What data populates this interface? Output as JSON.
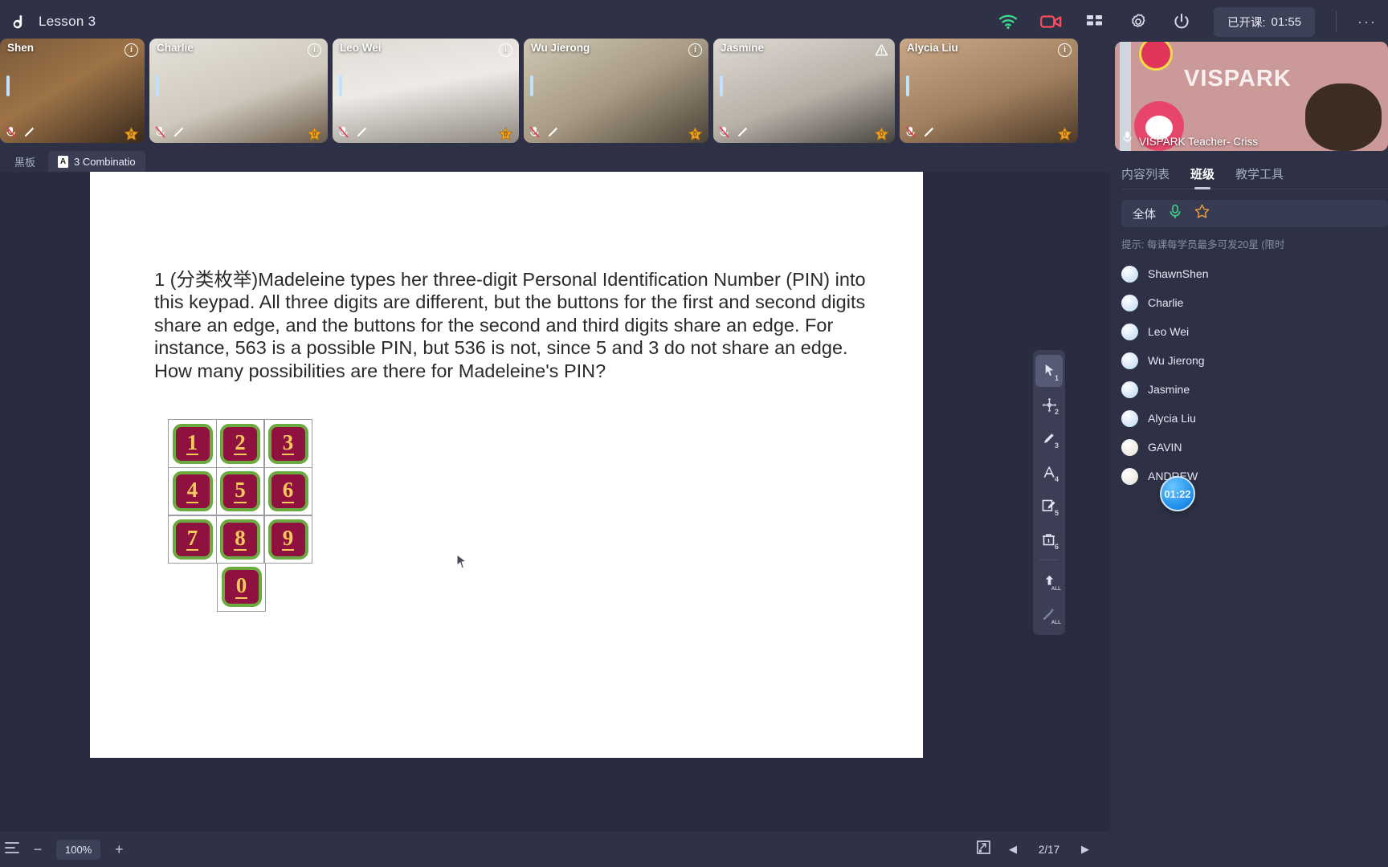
{
  "topbar": {
    "logo": "d-logo-icon",
    "lesson_title": "Lesson 3",
    "icons": [
      "wifi-icon",
      "camera-icon",
      "grid-layout-icon",
      "settings-gear-icon",
      "power-icon"
    ],
    "timer_label": "已开课:",
    "timer_value": "01:55",
    "more_label": "···"
  },
  "videos": [
    {
      "name": "Shen",
      "info": "i",
      "stars": "0",
      "bg": "linear-gradient(150deg,#7c5a3a,#9d7347 45%,#3a2a1c)"
    },
    {
      "name": "Charlie",
      "info": "i",
      "stars": "0",
      "bg": "linear-gradient(160deg,#e6e2da,#cfc9bd 55%,#6c5b4a)"
    },
    {
      "name": "Leo Wei",
      "info": "i",
      "stars": "0",
      "bg": "linear-gradient(170deg,#dedad4,#eeeae6 45%,#8e8880)"
    },
    {
      "name": "Wu Jierong",
      "info": "i",
      "stars": "0",
      "bg": "linear-gradient(150deg,#cfc7b4,#a89b86 50%,#4d4336)"
    },
    {
      "name": "Jasmine",
      "info": "!",
      "stars": "0",
      "bg": "linear-gradient(160deg,#ded9d2,#b7b1a8 55%,#4a4540)"
    },
    {
      "name": "Alycia Liu",
      "info": "i",
      "stars": "0",
      "bg": "linear-gradient(160deg,#c9a887,#a07f5e 55%,#4e3a28)"
    }
  ],
  "teacher": {
    "name": "VISPARK Teacher- Criss",
    "watermark": "VISPARK",
    "mic": "mic-icon"
  },
  "tabs": [
    {
      "label": "黑板",
      "active": false,
      "icon": null
    },
    {
      "label": "3 Combinatio",
      "active": true,
      "icon": "pdf-icon"
    }
  ],
  "board": {
    "problem_text": "1 (分类枚举)Madeleine types her three-digit Personal Identification Number (PIN) into this keypad. All three digits are different, but the buttons for the first and second digits share an edge, and the buttons for the second and third digits share an edge. For instance, 563 is a possible PIN, but 536 is not, since 5 and 3 do not share an edge. How many possibilities are there for Madeleine's PIN?",
    "keypad": {
      "rows": [
        [
          "1",
          "2",
          "3"
        ],
        [
          "4",
          "5",
          "6"
        ],
        [
          "7",
          "8",
          "9"
        ]
      ],
      "zero": "0",
      "button_fill": "#8f1140",
      "button_border": "#6aaa3e",
      "digit_color": "#f3c95a"
    }
  },
  "vtoolbar": [
    {
      "icon": "cursor-select-icon",
      "index": "1",
      "selected": true
    },
    {
      "icon": "move-pan-icon",
      "index": "2",
      "selected": false
    },
    {
      "icon": "pencil-icon",
      "index": "3",
      "selected": false
    },
    {
      "icon": "text-tool-icon",
      "index": "4",
      "selected": false
    },
    {
      "icon": "eraser-icon",
      "index": "5",
      "selected": false
    },
    {
      "icon": "trash-icon",
      "index": "6",
      "selected": false
    },
    {
      "icon": "upload-all-icon",
      "index": "ALL",
      "selected": false
    },
    {
      "icon": "magic-wand-all-icon",
      "index": "ALL",
      "selected": false
    }
  ],
  "rpanel": {
    "tabs": [
      {
        "label": "内容列表",
        "active": false
      },
      {
        "label": "班级",
        "active": true
      },
      {
        "label": "教学工具",
        "active": false
      }
    ],
    "all_label": "全体",
    "all_icons": [
      "mic-icon",
      "star-icon"
    ],
    "hint": "提示: 每课每学员最多可发20星 (限时",
    "students": [
      {
        "name": "ShawnShen",
        "avatar": "blue"
      },
      {
        "name": "Charlie",
        "avatar": "blue"
      },
      {
        "name": "Leo Wei",
        "avatar": "blue"
      },
      {
        "name": "Wu Jierong",
        "avatar": "blue"
      },
      {
        "name": "Jasmine",
        "avatar": "blue"
      },
      {
        "name": "Alycia Liu",
        "avatar": "blue"
      },
      {
        "name": "GAVIN",
        "avatar": "plain"
      },
      {
        "name": "ANDREW",
        "avatar": "plain"
      }
    ],
    "timer_bubble": "01:22"
  },
  "bottombar": {
    "minus": "−",
    "zoom": "100%",
    "plus": "+",
    "fit_icon": "fit-screen-icon",
    "prev_icon": "◀",
    "page": "2/17",
    "next_icon": "▶"
  },
  "colors": {
    "bg_dark": "#2e3145",
    "panel": "#3a3d54",
    "accent_green": "#3dd68c",
    "accent_red": "#ff4d5e",
    "star_gold": "#f0a722"
  }
}
